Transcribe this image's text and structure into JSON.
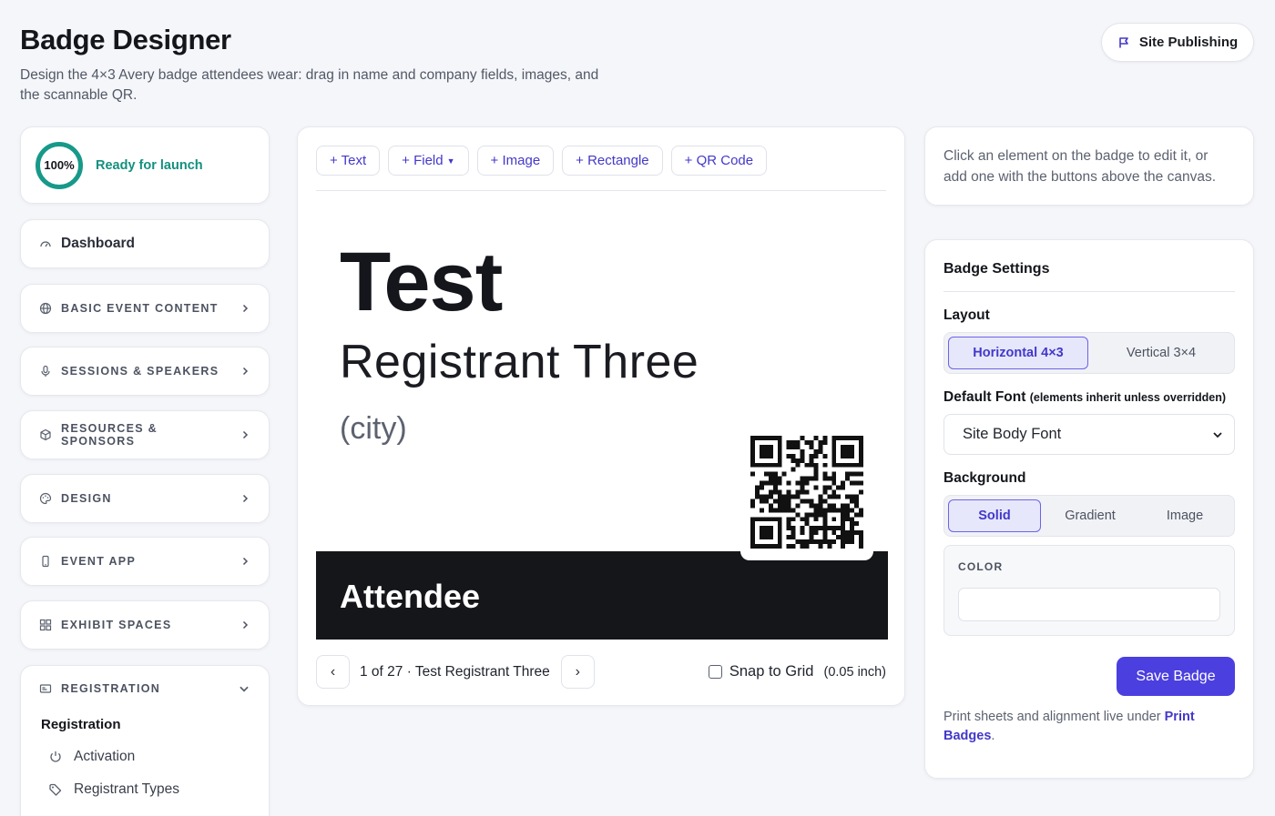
{
  "header": {
    "title": "Badge Designer",
    "description": "Design the 4×3 Avery badge attendees wear: drag in name and company fields, images, and the scannable QR.",
    "publish_label": "Site Publishing"
  },
  "sidebar": {
    "progress": {
      "percent_label": "100%",
      "percent": 100,
      "status": "Ready for launch"
    },
    "dashboard": "Dashboard",
    "sections": [
      {
        "label": "BASIC EVENT CONTENT",
        "icon": "globe-icon"
      },
      {
        "label": "SESSIONS & SPEAKERS",
        "icon": "microphone-icon"
      },
      {
        "label": "RESOURCES & SPONSORS",
        "icon": "box-icon"
      },
      {
        "label": "DESIGN",
        "icon": "palette-icon"
      },
      {
        "label": "EVENT APP",
        "icon": "phone-icon"
      },
      {
        "label": "EXHIBIT SPACES",
        "icon": "grid-icon"
      }
    ],
    "registration": {
      "label": "REGISTRATION",
      "subheading": "Registration",
      "items": [
        "Activation",
        "Registrant Types"
      ]
    }
  },
  "toolbar": {
    "text": "+ Text",
    "field": "+ Field",
    "image": "+ Image",
    "rectangle": "+ Rectangle",
    "qr": "+ QR Code"
  },
  "badge": {
    "first_name": "Test",
    "last_name": "Registrant Three",
    "city": "(city)",
    "type": "Attendee",
    "band_color": "#15161a"
  },
  "pager": {
    "prev": "‹",
    "next": "›",
    "text": "1 of 27 · Test Registrant Three",
    "snap_label": "Snap to Grid",
    "snap_unit": "(0.05 inch)",
    "snap_checked": false
  },
  "hint": "Click an element on the badge to edit it, or add one with the buttons above the canvas.",
  "settings": {
    "title": "Badge Settings",
    "layout_label": "Layout",
    "layout_options": [
      "Horizontal 4×3",
      "Vertical 3×4"
    ],
    "layout_selected": "Horizontal 4×3",
    "font_label": "Default Font",
    "font_note": "(elements inherit unless overridden)",
    "font_value": "Site Body Font",
    "background_label": "Background",
    "background_options": [
      "Solid",
      "Gradient",
      "Image"
    ],
    "background_selected": "Solid",
    "color_label": "COLOR",
    "color_value": "",
    "save_label": "Save Badge",
    "footer_text": "Print sheets and alignment live under ",
    "footer_link": "Print Badges",
    "footer_end": "."
  },
  "colors": {
    "accent": "#4b3fe0",
    "success": "#17998a",
    "badge_band": "#15161a"
  }
}
